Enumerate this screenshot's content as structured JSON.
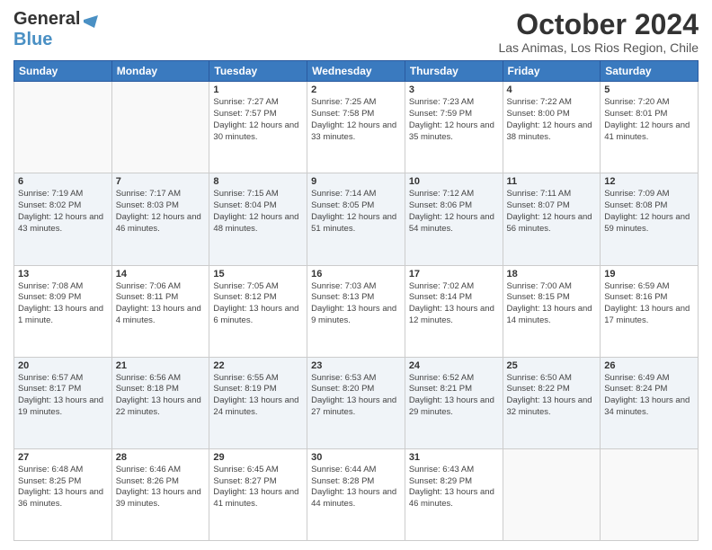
{
  "header": {
    "logo_line1": "General",
    "logo_line2": "Blue",
    "month": "October 2024",
    "location": "Las Animas, Los Rios Region, Chile"
  },
  "days_of_week": [
    "Sunday",
    "Monday",
    "Tuesday",
    "Wednesday",
    "Thursday",
    "Friday",
    "Saturday"
  ],
  "weeks": [
    [
      {
        "day": "",
        "sunrise": "",
        "sunset": "",
        "daylight": ""
      },
      {
        "day": "",
        "sunrise": "",
        "sunset": "",
        "daylight": ""
      },
      {
        "day": "1",
        "sunrise": "Sunrise: 7:27 AM",
        "sunset": "Sunset: 7:57 PM",
        "daylight": "Daylight: 12 hours and 30 minutes."
      },
      {
        "day": "2",
        "sunrise": "Sunrise: 7:25 AM",
        "sunset": "Sunset: 7:58 PM",
        "daylight": "Daylight: 12 hours and 33 minutes."
      },
      {
        "day": "3",
        "sunrise": "Sunrise: 7:23 AM",
        "sunset": "Sunset: 7:59 PM",
        "daylight": "Daylight: 12 hours and 35 minutes."
      },
      {
        "day": "4",
        "sunrise": "Sunrise: 7:22 AM",
        "sunset": "Sunset: 8:00 PM",
        "daylight": "Daylight: 12 hours and 38 minutes."
      },
      {
        "day": "5",
        "sunrise": "Sunrise: 7:20 AM",
        "sunset": "Sunset: 8:01 PM",
        "daylight": "Daylight: 12 hours and 41 minutes."
      }
    ],
    [
      {
        "day": "6",
        "sunrise": "Sunrise: 7:19 AM",
        "sunset": "Sunset: 8:02 PM",
        "daylight": "Daylight: 12 hours and 43 minutes."
      },
      {
        "day": "7",
        "sunrise": "Sunrise: 7:17 AM",
        "sunset": "Sunset: 8:03 PM",
        "daylight": "Daylight: 12 hours and 46 minutes."
      },
      {
        "day": "8",
        "sunrise": "Sunrise: 7:15 AM",
        "sunset": "Sunset: 8:04 PM",
        "daylight": "Daylight: 12 hours and 48 minutes."
      },
      {
        "day": "9",
        "sunrise": "Sunrise: 7:14 AM",
        "sunset": "Sunset: 8:05 PM",
        "daylight": "Daylight: 12 hours and 51 minutes."
      },
      {
        "day": "10",
        "sunrise": "Sunrise: 7:12 AM",
        "sunset": "Sunset: 8:06 PM",
        "daylight": "Daylight: 12 hours and 54 minutes."
      },
      {
        "day": "11",
        "sunrise": "Sunrise: 7:11 AM",
        "sunset": "Sunset: 8:07 PM",
        "daylight": "Daylight: 12 hours and 56 minutes."
      },
      {
        "day": "12",
        "sunrise": "Sunrise: 7:09 AM",
        "sunset": "Sunset: 8:08 PM",
        "daylight": "Daylight: 12 hours and 59 minutes."
      }
    ],
    [
      {
        "day": "13",
        "sunrise": "Sunrise: 7:08 AM",
        "sunset": "Sunset: 8:09 PM",
        "daylight": "Daylight: 13 hours and 1 minute."
      },
      {
        "day": "14",
        "sunrise": "Sunrise: 7:06 AM",
        "sunset": "Sunset: 8:11 PM",
        "daylight": "Daylight: 13 hours and 4 minutes."
      },
      {
        "day": "15",
        "sunrise": "Sunrise: 7:05 AM",
        "sunset": "Sunset: 8:12 PM",
        "daylight": "Daylight: 13 hours and 6 minutes."
      },
      {
        "day": "16",
        "sunrise": "Sunrise: 7:03 AM",
        "sunset": "Sunset: 8:13 PM",
        "daylight": "Daylight: 13 hours and 9 minutes."
      },
      {
        "day": "17",
        "sunrise": "Sunrise: 7:02 AM",
        "sunset": "Sunset: 8:14 PM",
        "daylight": "Daylight: 13 hours and 12 minutes."
      },
      {
        "day": "18",
        "sunrise": "Sunrise: 7:00 AM",
        "sunset": "Sunset: 8:15 PM",
        "daylight": "Daylight: 13 hours and 14 minutes."
      },
      {
        "day": "19",
        "sunrise": "Sunrise: 6:59 AM",
        "sunset": "Sunset: 8:16 PM",
        "daylight": "Daylight: 13 hours and 17 minutes."
      }
    ],
    [
      {
        "day": "20",
        "sunrise": "Sunrise: 6:57 AM",
        "sunset": "Sunset: 8:17 PM",
        "daylight": "Daylight: 13 hours and 19 minutes."
      },
      {
        "day": "21",
        "sunrise": "Sunrise: 6:56 AM",
        "sunset": "Sunset: 8:18 PM",
        "daylight": "Daylight: 13 hours and 22 minutes."
      },
      {
        "day": "22",
        "sunrise": "Sunrise: 6:55 AM",
        "sunset": "Sunset: 8:19 PM",
        "daylight": "Daylight: 13 hours and 24 minutes."
      },
      {
        "day": "23",
        "sunrise": "Sunrise: 6:53 AM",
        "sunset": "Sunset: 8:20 PM",
        "daylight": "Daylight: 13 hours and 27 minutes."
      },
      {
        "day": "24",
        "sunrise": "Sunrise: 6:52 AM",
        "sunset": "Sunset: 8:21 PM",
        "daylight": "Daylight: 13 hours and 29 minutes."
      },
      {
        "day": "25",
        "sunrise": "Sunrise: 6:50 AM",
        "sunset": "Sunset: 8:22 PM",
        "daylight": "Daylight: 13 hours and 32 minutes."
      },
      {
        "day": "26",
        "sunrise": "Sunrise: 6:49 AM",
        "sunset": "Sunset: 8:24 PM",
        "daylight": "Daylight: 13 hours and 34 minutes."
      }
    ],
    [
      {
        "day": "27",
        "sunrise": "Sunrise: 6:48 AM",
        "sunset": "Sunset: 8:25 PM",
        "daylight": "Daylight: 13 hours and 36 minutes."
      },
      {
        "day": "28",
        "sunrise": "Sunrise: 6:46 AM",
        "sunset": "Sunset: 8:26 PM",
        "daylight": "Daylight: 13 hours and 39 minutes."
      },
      {
        "day": "29",
        "sunrise": "Sunrise: 6:45 AM",
        "sunset": "Sunset: 8:27 PM",
        "daylight": "Daylight: 13 hours and 41 minutes."
      },
      {
        "day": "30",
        "sunrise": "Sunrise: 6:44 AM",
        "sunset": "Sunset: 8:28 PM",
        "daylight": "Daylight: 13 hours and 44 minutes."
      },
      {
        "day": "31",
        "sunrise": "Sunrise: 6:43 AM",
        "sunset": "Sunset: 8:29 PM",
        "daylight": "Daylight: 13 hours and 46 minutes."
      },
      {
        "day": "",
        "sunrise": "",
        "sunset": "",
        "daylight": ""
      },
      {
        "day": "",
        "sunrise": "",
        "sunset": "",
        "daylight": ""
      }
    ]
  ]
}
